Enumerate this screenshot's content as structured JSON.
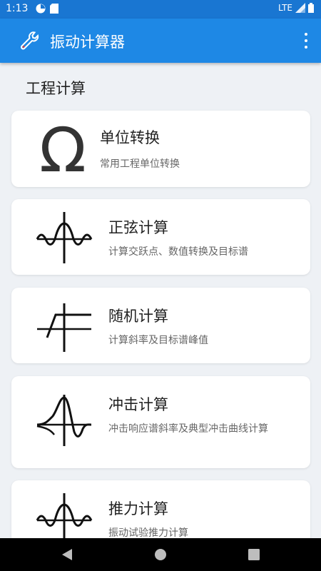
{
  "status_bar": {
    "time": "1:13",
    "network": "LTE"
  },
  "app_bar": {
    "title": "振动计算器",
    "logo_icon": "wrench-icon",
    "menu_icon": "more-vert-icon"
  },
  "section": {
    "title": "工程计算"
  },
  "cards": [
    {
      "title": "单位转换",
      "desc": "常用工程单位转换",
      "icon": "omega-icon"
    },
    {
      "title": "正弦计算",
      "desc": "计算交跃点、数值转换及目标谱",
      "icon": "sine-wave-icon"
    },
    {
      "title": "随机计算",
      "desc": "计算斜率及目标谱峰值",
      "icon": "random-spectrum-icon"
    },
    {
      "title": "冲击计算",
      "desc": "冲击响应谱斜率及典型冲击曲线计算",
      "icon": "shock-pulse-icon"
    },
    {
      "title": "推力计算",
      "desc": "振动试验推力计算",
      "icon": "sine-wave-icon"
    }
  ],
  "colors": {
    "status_bar": "#1976d2",
    "app_bar": "#1e88e5",
    "background": "#eef1f5"
  }
}
